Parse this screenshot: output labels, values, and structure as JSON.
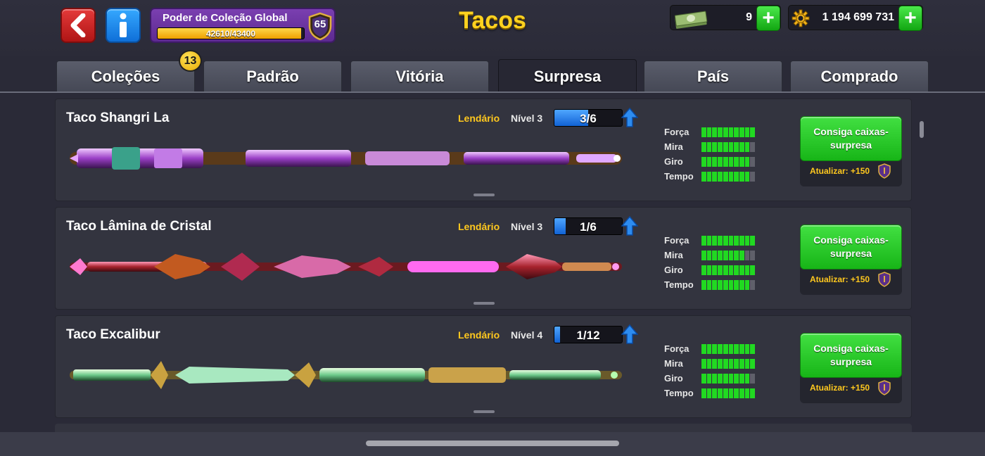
{
  "header": {
    "title": "Tacos",
    "power": {
      "title": "Poder de Coleção Global",
      "progress_text": "42610/43400",
      "current": 42610,
      "max": 43400,
      "level": "65"
    },
    "cash": {
      "value": "9"
    },
    "coins": {
      "value": "1 194 699 731"
    },
    "colors": {
      "title": "#ffd21f",
      "accent_green": "#21d921",
      "rarity": "#ffc81e"
    }
  },
  "tabs": [
    {
      "label": "Coleções",
      "badge": "13"
    },
    {
      "label": "Padrão"
    },
    {
      "label": "Vitória"
    },
    {
      "label": "Surpresa",
      "active": true
    },
    {
      "label": "País"
    },
    {
      "label": "Comprado"
    }
  ],
  "cues": [
    {
      "name": "Taco Shangri La",
      "rarity": "Lendário",
      "level": "Nível 3",
      "progress_text": "3/6",
      "progress": 0.5,
      "style": "shangri",
      "stats": [
        {
          "label": "Força",
          "value": 10
        },
        {
          "label": "Mira",
          "value": 9
        },
        {
          "label": "Giro",
          "value": 9
        },
        {
          "label": "Tempo",
          "value": 9
        }
      ],
      "button": "Consiga caixas-surpresa",
      "upgrade": "Atualizar: +150"
    },
    {
      "name": "Taco Lâmina de Cristal",
      "rarity": "Lendário",
      "level": "Nível 3",
      "progress_text": "1/6",
      "progress": 0.1667,
      "style": "crystal",
      "stats": [
        {
          "label": "Força",
          "value": 10
        },
        {
          "label": "Mira",
          "value": 8
        },
        {
          "label": "Giro",
          "value": 10
        },
        {
          "label": "Tempo",
          "value": 9
        }
      ],
      "button": "Consiga caixas-surpresa",
      "upgrade": "Atualizar: +150"
    },
    {
      "name": "Taco Excalibur",
      "rarity": "Lendário",
      "level": "Nível 4",
      "progress_text": "1/12",
      "progress": 0.0833,
      "style": "excalibur",
      "stats": [
        {
          "label": "Força",
          "value": 10
        },
        {
          "label": "Mira",
          "value": 10
        },
        {
          "label": "Giro",
          "value": 9
        },
        {
          "label": "Tempo",
          "value": 10
        }
      ],
      "button": "Consiga caixas-surpresa",
      "upgrade": "Atualizar: +150"
    }
  ],
  "icons": {
    "back": "chevron-left-icon",
    "info": "info-icon",
    "cash": "cash-stack-icon",
    "coins": "gear-coin-icon",
    "plus": "plus-icon",
    "upgrade_arrow": "arrow-up-icon",
    "upgrade_shield": "shield-icon"
  }
}
